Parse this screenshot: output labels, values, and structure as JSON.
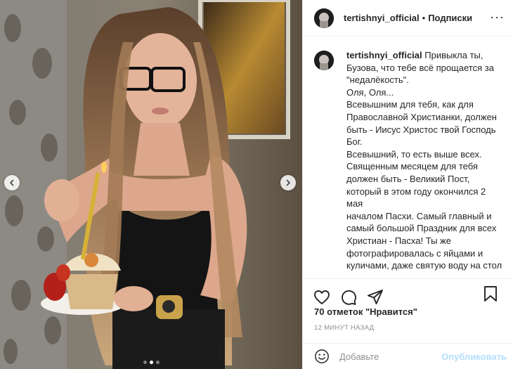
{
  "post": {
    "username": "tertishnyi_official",
    "separator": "•",
    "follow_label": "Подписки",
    "more_label": "···",
    "caption_username": "tertishnyi_official",
    "caption_text": " Привыкла ты,\nБузова, что тебе всё прощается за\n\"недалёкость\".\nОля, Оля...\nВсевышним для тебя, как для\nПравославной Христианки, должен\nбыть - Иисус Христос твой Господь\nБог.\nВсевышний, то есть выше всех.\nСвященным месяцем для тебя\nдолжен быть - Великий Пост,\nкоторый в этом году окончился 2 мая\nначалом Пасхи. Самый главный и\nсамый большой Праздник для всех\nХристиан - Пасха! Ты же\nфотографировалась с яйцами и\nкуличами, даже святую воду на стол\nпоставила и свечи для домашней\nмолитвы положила. Или это был\nпросто реквизит?",
    "likes_text": "70 отметок \"Нравится\"",
    "time_text": "12 МИНУТ НАЗАД",
    "comment_placeholder": "Добавьте",
    "publish_label": "Опубликовать"
  },
  "carousel": {
    "slides": 3,
    "active_index": 1
  },
  "icons": {
    "prev": "chevron-left-icon",
    "next": "chevron-right-icon",
    "like": "heart-icon",
    "comment": "comment-icon",
    "share": "share-icon",
    "save": "bookmark-icon",
    "emoji": "smile-icon"
  },
  "colors": {
    "publish_disabled": "#b2dffc",
    "muted": "#8e8e8e",
    "text": "#262626",
    "border": "#efefef"
  }
}
